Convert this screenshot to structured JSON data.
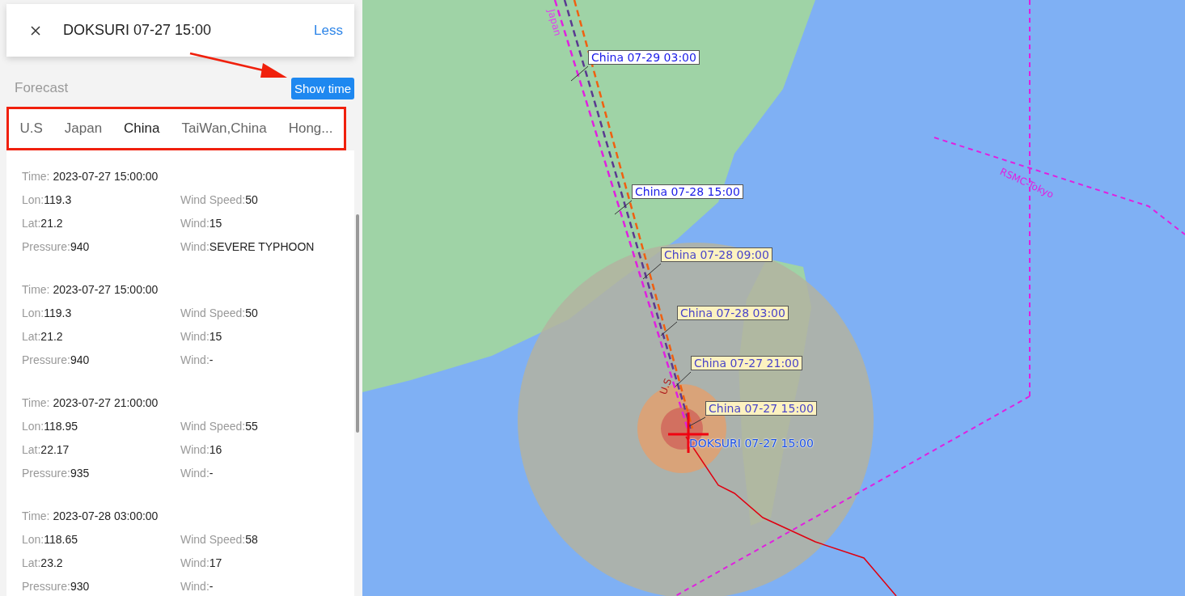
{
  "header": {
    "title": "DOKSURI 07-27 15:00",
    "toggle": "Less"
  },
  "forecast": {
    "title": "Forecast",
    "button": "Show time"
  },
  "tabs": [
    {
      "label": "U.S",
      "selected": false
    },
    {
      "label": "Japan",
      "selected": false
    },
    {
      "label": "China",
      "selected": true
    },
    {
      "label": "TaiWan,China",
      "selected": false
    },
    {
      "label": "Hong...",
      "selected": false
    }
  ],
  "records": [
    {
      "time_label": "Time:",
      "time": "2023-07-27 15:00:00",
      "fields": [
        {
          "label": "Lon:",
          "value": "119.3"
        },
        {
          "label": "Wind Speed:",
          "value": "50"
        },
        {
          "label": "Lat:",
          "value": "21.2"
        },
        {
          "label": "Wind:",
          "value": "15"
        },
        {
          "label": "Pressure:",
          "value": "940"
        },
        {
          "label": "Wind:",
          "value": "SEVERE TYPHOON"
        }
      ]
    },
    {
      "time_label": "Time:",
      "time": "2023-07-27 15:00:00",
      "fields": [
        {
          "label": "Lon:",
          "value": "119.3"
        },
        {
          "label": "Wind Speed:",
          "value": "50"
        },
        {
          "label": "Lat:",
          "value": "21.2"
        },
        {
          "label": "Wind:",
          "value": "15"
        },
        {
          "label": "Pressure:",
          "value": "940"
        },
        {
          "label": "Wind:",
          "value": "-"
        }
      ]
    },
    {
      "time_label": "Time:",
      "time": "2023-07-27 21:00:00",
      "fields": [
        {
          "label": "Lon:",
          "value": "118.95"
        },
        {
          "label": "Wind Speed:",
          "value": "55"
        },
        {
          "label": "Lat:",
          "value": "22.17"
        },
        {
          "label": "Wind:",
          "value": "16"
        },
        {
          "label": "Pressure:",
          "value": "935"
        },
        {
          "label": "Wind:",
          "value": "-"
        }
      ]
    },
    {
      "time_label": "Time:",
      "time": "2023-07-28 03:00:00",
      "fields": [
        {
          "label": "Lon:",
          "value": "118.65"
        },
        {
          "label": "Wind Speed:",
          "value": "58"
        },
        {
          "label": "Lat:",
          "value": "23.2"
        },
        {
          "label": "Wind:",
          "value": "17"
        },
        {
          "label": "Pressure:",
          "value": "930"
        },
        {
          "label": "Wind:",
          "value": "-"
        }
      ]
    }
  ],
  "map": {
    "forecast_labels": [
      {
        "text": "China 07-29 03:00",
        "shaded": false
      },
      {
        "text": "China 07-28 15:00",
        "shaded": false
      },
      {
        "text": "China 07-28 09:00",
        "shaded": true
      },
      {
        "text": "China 07-28 03:00",
        "shaded": true
      },
      {
        "text": "China 07-27 21:00",
        "shaded": true
      },
      {
        "text": "China 07-27 15:00",
        "shaded": true
      }
    ],
    "track_labels": [
      {
        "text": "Japan"
      },
      {
        "text": "U.S"
      },
      {
        "text": "RSMC-Tokyo"
      }
    ],
    "typhoon_label": "DOKSURI 07-27 15:00"
  }
}
